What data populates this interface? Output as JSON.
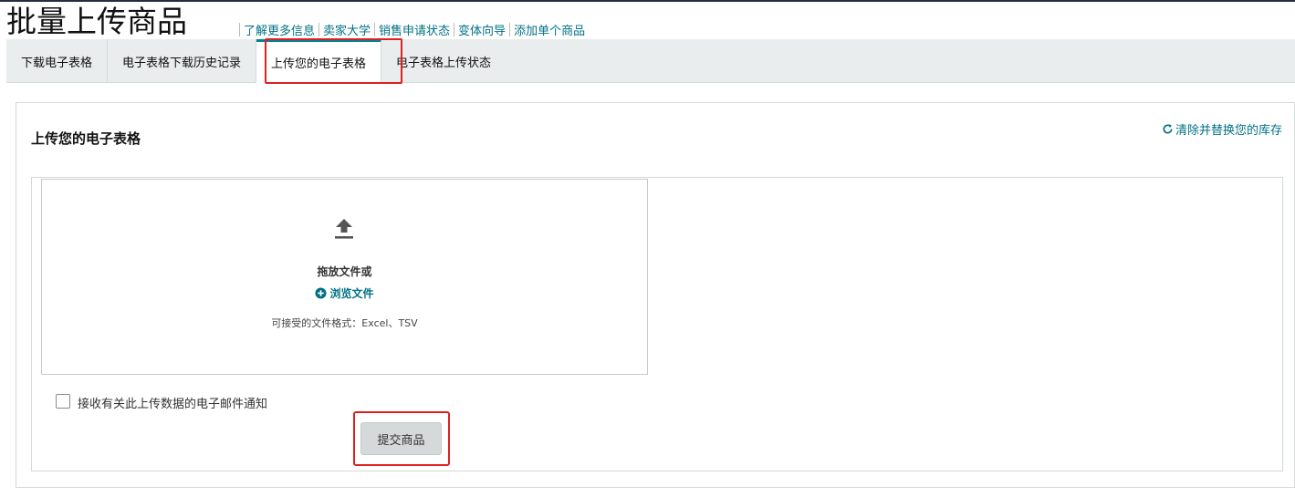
{
  "page": {
    "title": "批量上传商品"
  },
  "header_links": [
    {
      "label": "了解更多信息"
    },
    {
      "label": "卖家大学"
    },
    {
      "label": "销售申请状态"
    },
    {
      "label": "变体向导"
    },
    {
      "label": "添加单个商品"
    }
  ],
  "tabs": [
    {
      "label": "下载电子表格"
    },
    {
      "label": "电子表格下载历史记录"
    },
    {
      "label": "上传您的电子表格",
      "active": true
    },
    {
      "label": "电子表格上传状态"
    }
  ],
  "panel": {
    "title": "上传您的电子表格",
    "reset_link": "清除并替换您的库存"
  },
  "dropzone": {
    "drag_text": "拖放文件或",
    "browse_label": "浏览文件",
    "formats_text": "可接受的文件格式：Excel、TSV"
  },
  "email_option": {
    "label": "接收有关此上传数据的电子邮件通知",
    "checked": false
  },
  "submit": {
    "label": "提交商品"
  },
  "icons": {
    "upload": "upload-icon",
    "browse": "plus-circle-icon",
    "reset": "refresh-icon"
  },
  "colors": {
    "link": "#007185",
    "highlight": "#e02020",
    "tab_accent": "#008296"
  }
}
